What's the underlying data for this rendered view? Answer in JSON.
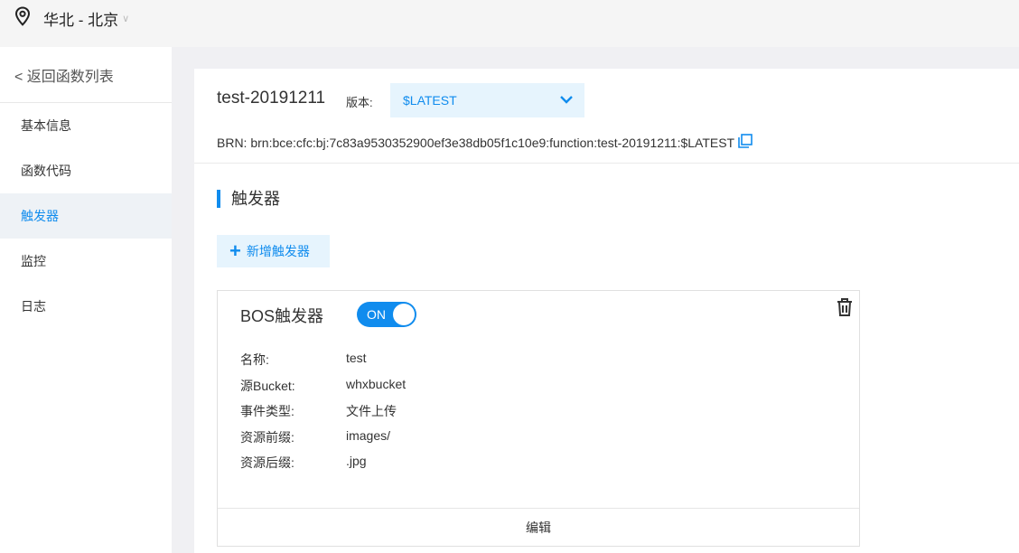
{
  "topbar": {
    "region": "华北 - 北京",
    "location_icon": "location-pin-icon",
    "chevron_icon": "chevron-down-icon"
  },
  "sidebar": {
    "back_label": "< 返回函数列表",
    "items": [
      {
        "label": "基本信息",
        "active": false
      },
      {
        "label": "函数代码",
        "active": false
      },
      {
        "label": "触发器",
        "active": true
      },
      {
        "label": "监控",
        "active": false
      },
      {
        "label": "日志",
        "active": false
      }
    ]
  },
  "header": {
    "function_name": "test-20191211",
    "version_label": "版本:",
    "version_value": "$LATEST",
    "brn": "BRN:  brn:bce:cfc:bj:7c83a9530352900ef3e38db05f1c10e9:function:test-20191211:$LATEST"
  },
  "section": {
    "title": "触发器",
    "add_button": "新增触发器"
  },
  "trigger": {
    "title": "BOS触发器",
    "toggle_label": "ON",
    "fields": [
      {
        "key": "名称:",
        "value": "test"
      },
      {
        "key": "源Bucket:",
        "value": "whxbucket"
      },
      {
        "key": "事件类型:",
        "value": "文件上传"
      },
      {
        "key": "资源前缀:",
        "value": "images/"
      },
      {
        "key": "资源后缀:",
        "value": ".jpg"
      }
    ],
    "edit_label": "编辑"
  },
  "colors": {
    "accent": "#108cee",
    "accent_bg": "#e6f4fd",
    "active_nav_bg": "#eef2f6"
  }
}
